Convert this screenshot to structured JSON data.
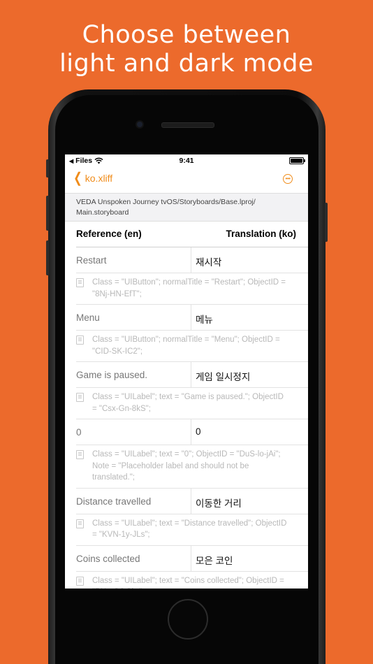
{
  "headline": {
    "line1": "Choose between",
    "line2": "light and dark mode"
  },
  "status_bar": {
    "back_app": "Files",
    "time": "9:41"
  },
  "nav": {
    "back_label": "ko.xliff",
    "more_icon": "ellipsis-circle-icon",
    "accent_color": "#f08c1a"
  },
  "path": "VEDA Unspoken Journey tvOS/Storyboards/Base.lproj/ Main.storyboard",
  "columns": {
    "reference": "Reference (en)",
    "translation": "Translation (ko)"
  },
  "entries": [
    {
      "source": "Restart",
      "target": "재시작",
      "note": "Class = \"UIButton\"; normalTitle = \"Restart\"; ObjectID = \"8Nj-HN-EfT\";"
    },
    {
      "source": "Menu",
      "target": "메뉴",
      "note": "Class = \"UIButton\"; normalTitle = \"Menu\"; ObjectID = \"CID-SK-IC2\";"
    },
    {
      "source": "Game is paused.",
      "target": "게임 일시정지",
      "note": "Class = \"UILabel\"; text = \"Game is paused.\"; ObjectID = \"Csx-Gn-8kS\";"
    },
    {
      "source": "0",
      "target": "0",
      "note": "Class = \"UILabel\"; text = \"0\"; ObjectID = \"DuS-lo-jAi\"; Note = \"Placeholder label and should not be translated.\";"
    },
    {
      "source": "Distance travelled",
      "target": "이동한 거리",
      "note": "Class = \"UILabel\"; text = \"Distance travelled\"; ObjectID = \"KVN-1y-JLs\";"
    },
    {
      "source": "Coins collected",
      "target": "모은 코인",
      "note": "Class = \"UILabel\"; text = \"Coins collected\"; ObjectID = \"PNg-OJ-Slw\";"
    }
  ]
}
